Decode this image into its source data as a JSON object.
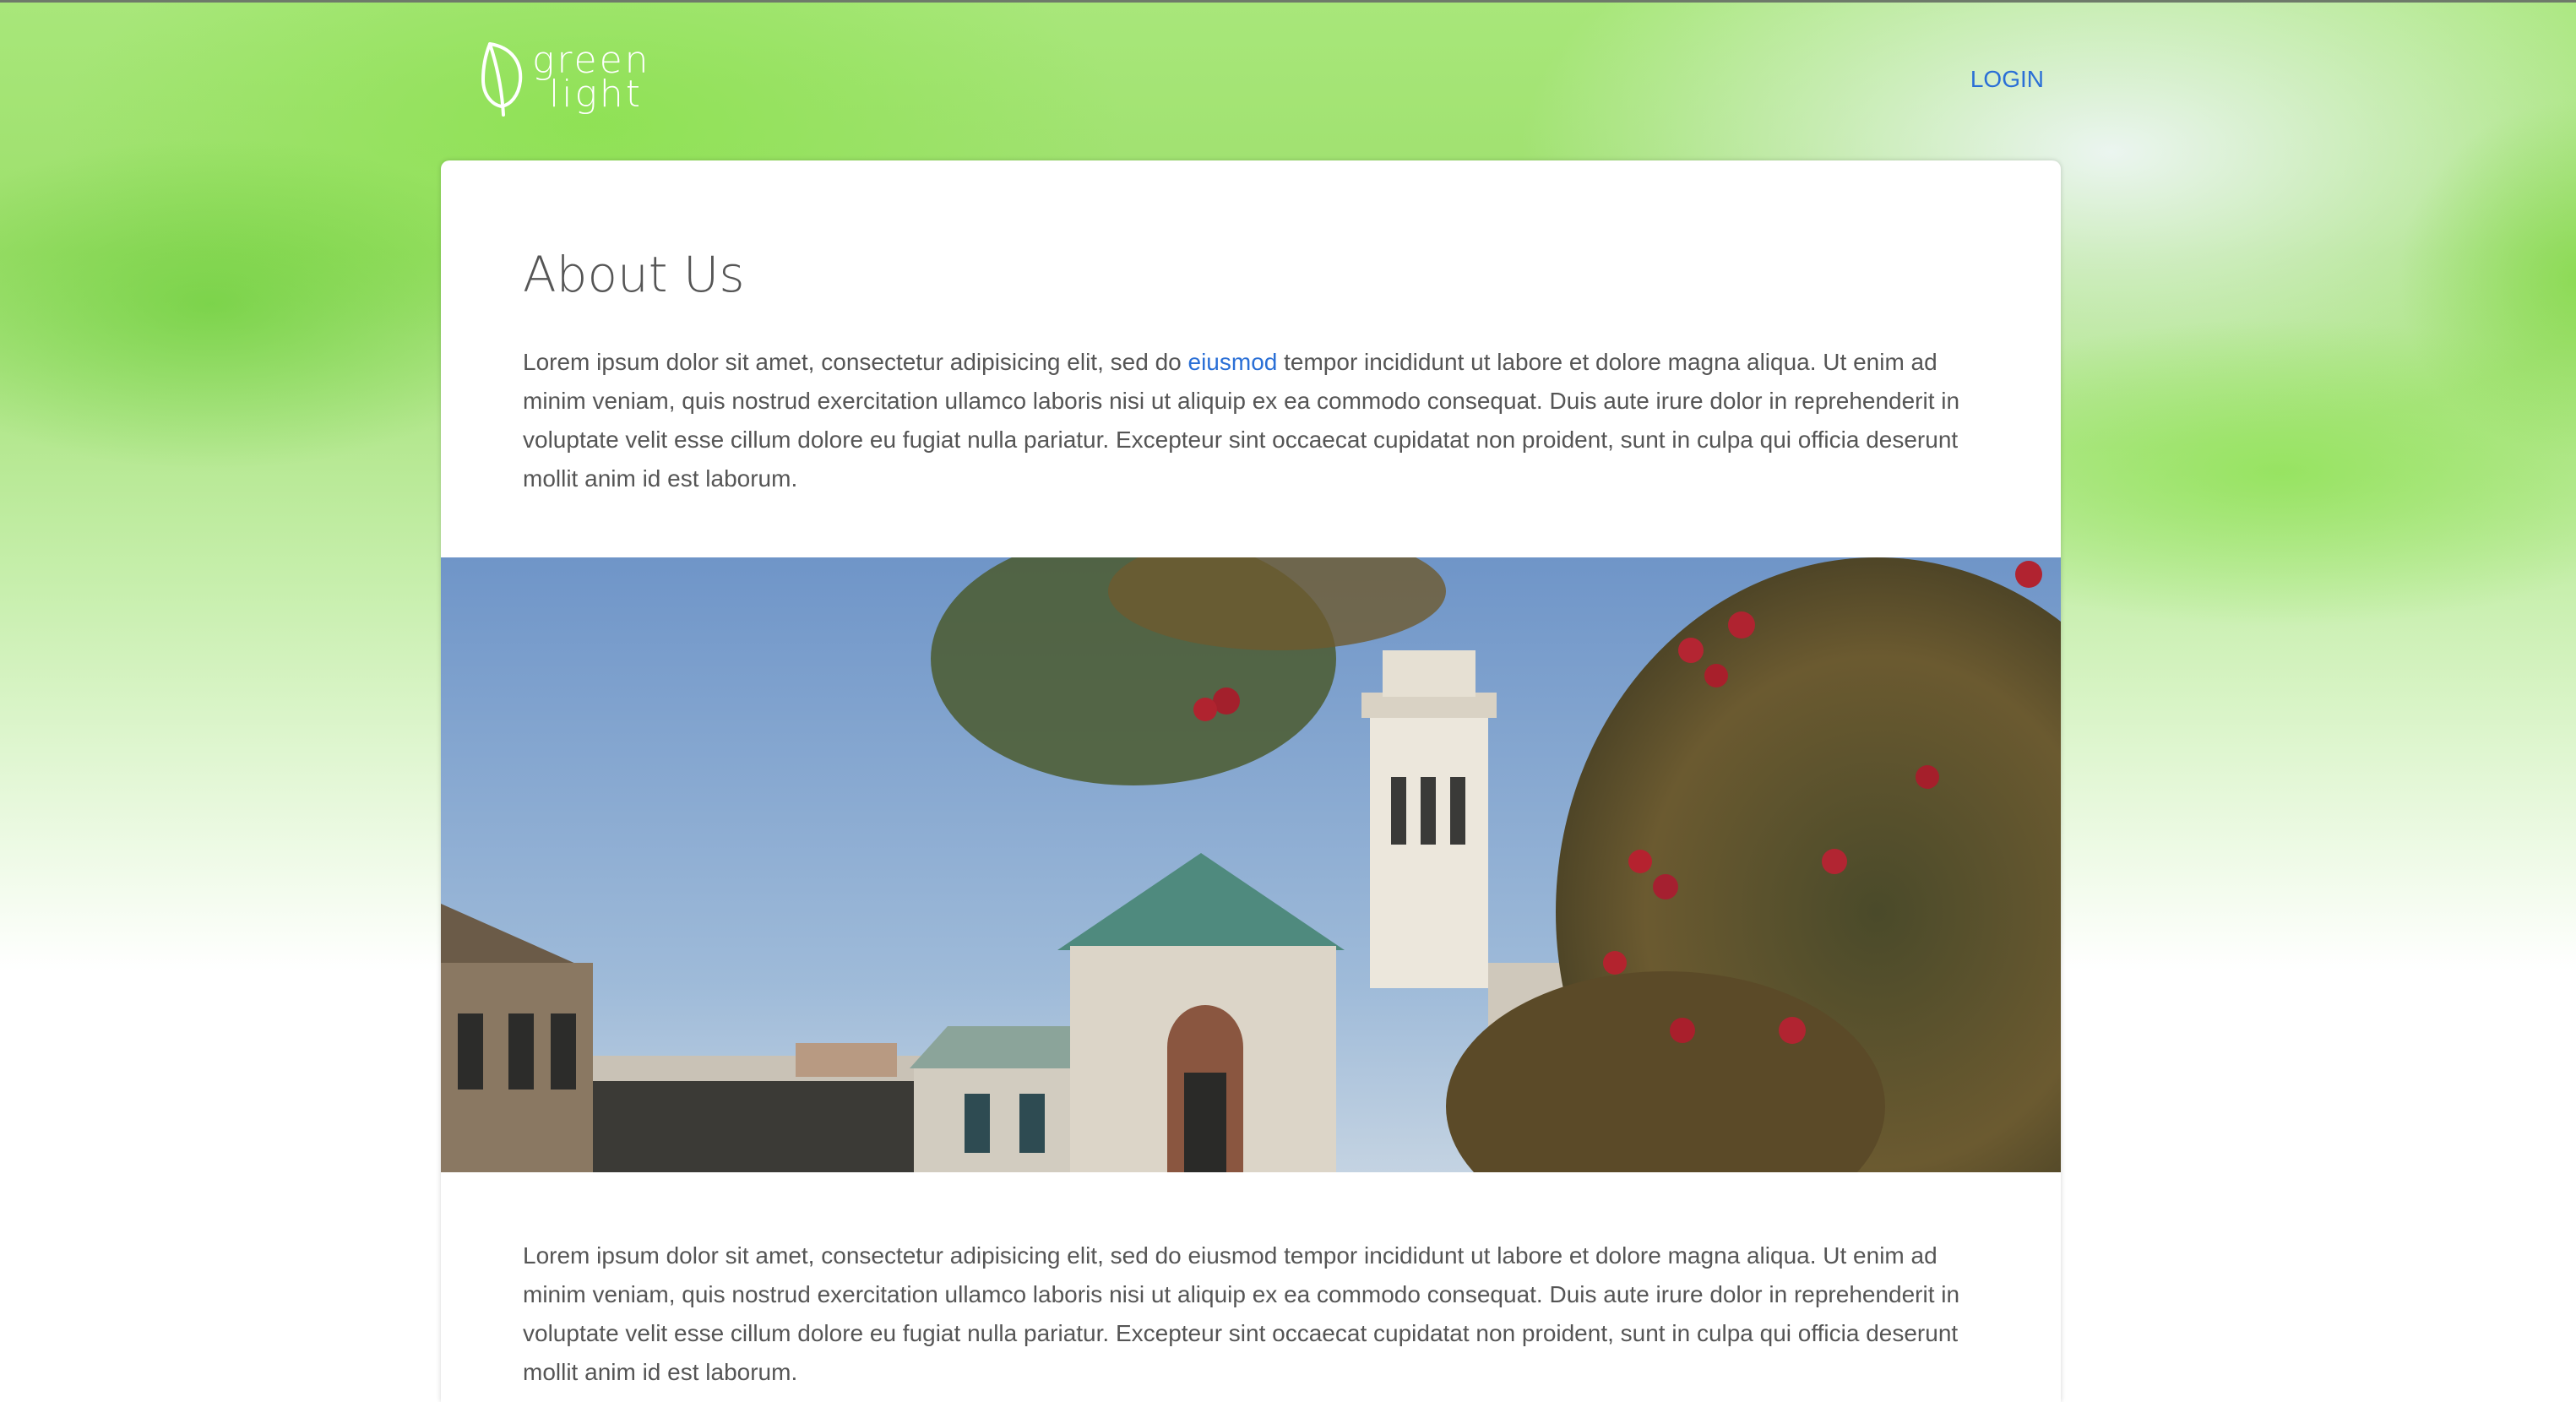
{
  "brand": {
    "logo_line1": "green",
    "logo_line2": "light"
  },
  "nav": {
    "login_label": "LOGIN"
  },
  "page": {
    "title": "About Us",
    "para1_before_link": "Lorem ipsum dolor sit amet, consectetur adipisicing elit, sed do ",
    "para1_link": "eiusmod",
    "para1_after_link": " tempor incididunt ut labore et dolore magna aliqua. Ut enim ad minim veniam, quis nostrud exercitation ullamco laboris nisi ut aliquip ex ea commodo consequat. Duis aute irure dolor in reprehenderit in voluptate velit esse cillum dolore eu fugiat nulla pariatur. Excepteur sint occaecat cupidatat non proident, sunt in culpa qui officia deserunt mollit anim id est laborum.",
    "para2": "Lorem ipsum dolor sit amet, consectetur adipisicing elit, sed do eiusmod tempor incididunt ut labore et dolore magna aliqua. Ut enim ad minim veniam, quis nostrud exercitation ullamco laboris nisi ut aliquip ex ea commodo consequat. Duis aute irure dolor in reprehenderit in voluptate velit esse cillum dolore eu fugiat nulla pariatur. Excepteur sint occaecat cupidatat non proident, sunt in culpa qui officia deserunt mollit anim id est laborum."
  },
  "colors": {
    "accent_link": "#2a6fd6",
    "body_text": "#555555",
    "background_green": "#9ddf6c"
  },
  "icons": {
    "logo_mark": "leaf-icon"
  }
}
